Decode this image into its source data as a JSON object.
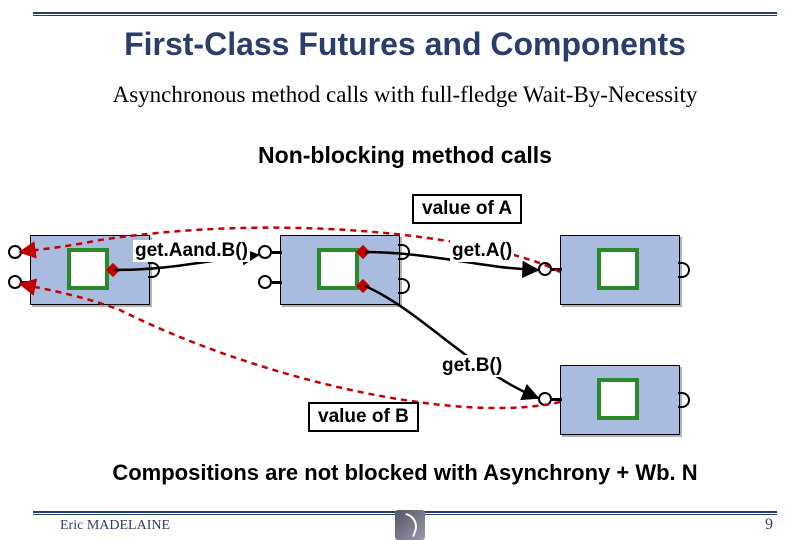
{
  "title": "First-Class Futures and Components",
  "subtitle": "Asynchronous method calls with full-fledge Wait-By-Necessity",
  "subheading": "Non-blocking method calls",
  "diagram": {
    "call1": "get.Aand.B()",
    "call2": "get.A()",
    "call3": "get.B()",
    "valueA": "value of A",
    "valueB": "value of B"
  },
  "conclusion": "Compositions are not blocked with  Asynchrony + Wb. N",
  "author": "Eric MADELAINE",
  "pagenum": "9"
}
